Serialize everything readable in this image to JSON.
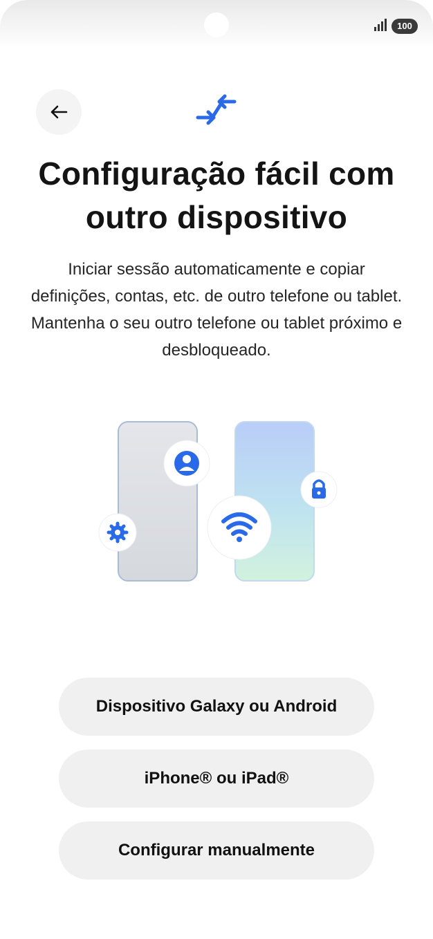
{
  "status_bar": {
    "battery": "100",
    "signal_icon": "signal-bars-icon"
  },
  "header": {
    "back_icon": "arrow-left-icon",
    "hero_icon": "transfer-arrows-icon"
  },
  "title": "Configuração fácil com outro dispositivo",
  "subtitle": "Iniciar sessão automaticamente e copiar definições, contas, etc. de outro telefone ou tablet. Mantenha o seu outro telefone ou tablet próximo e desbloqueado.",
  "illustration": {
    "icons": [
      "gear-icon",
      "person-icon",
      "wifi-icon",
      "lock-icon"
    ]
  },
  "options": {
    "galaxy": "Dispositivo Galaxy ou Android",
    "iphone": "iPhone® ou iPad®",
    "manual": "Configurar manualmente"
  },
  "colors": {
    "accent": "#2a6ae8",
    "button_bg": "#f0f0f1"
  }
}
